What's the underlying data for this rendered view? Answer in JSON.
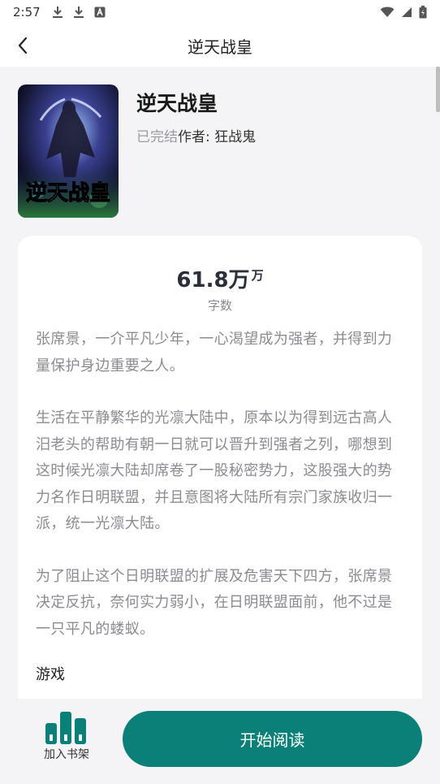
{
  "status_bar": {
    "time": "2:57",
    "left_icons": [
      "download-icon",
      "download-icon",
      "font-app-icon"
    ],
    "right_icons": [
      "wifi-icon",
      "cellular-signal-icon",
      "battery-charging-icon"
    ]
  },
  "app_bar": {
    "back_icon": "chevron-left-icon",
    "title": "逆天战皇"
  },
  "book": {
    "title": "逆天战皇",
    "status": "已完结",
    "author": "作者: 狂战鬼",
    "cover_text": "逆天战皇"
  },
  "stats": {
    "word_count": "61.8万",
    "word_count_unit": "万",
    "word_count_label": "字数"
  },
  "synopsis": [
    "张席景，一介平凡少年，一心渴望成为强者，并得到力量保护身边重要之人。",
    "生活在平静繁华的光凛大陆中，原本以为得到远古高人汨老头的帮助有朝一日就可以晋升到强者之列，哪想到这时候光凛大陆却席卷了一股秘密势力，这股强大的势力名作日明联盟，并且意图将大陆所有宗门家族收归一派，统一光凛大陆。",
    "为了阻止这个日明联盟的扩展及危害天下四方，张席景决定反抗，奈何实力弱小，在日明联盟面前，他不过是一只平凡的蝼蚁。"
  ],
  "genre": "游戏",
  "bottom_bar": {
    "add_shelf_label": "加入书架",
    "start_reading_label": "开始阅读"
  },
  "colors": {
    "accent": "#0b8078",
    "background": "#f4f4f6",
    "card": "#ffffff",
    "muted_text": "#8b8b93"
  }
}
